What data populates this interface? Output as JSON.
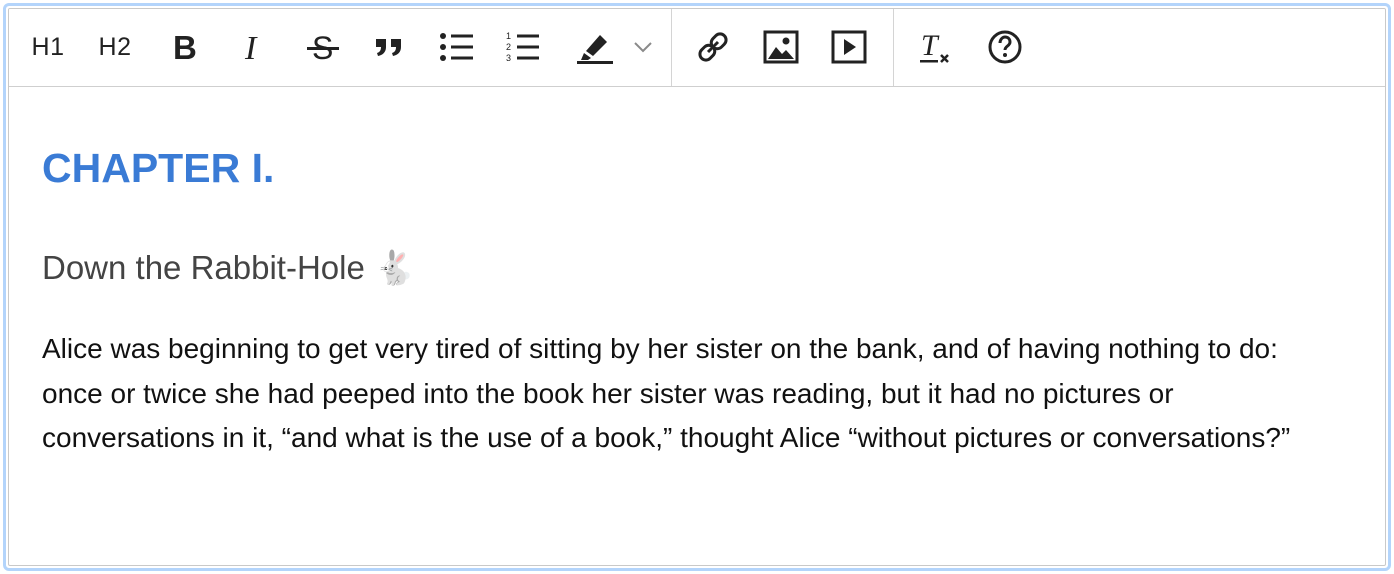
{
  "toolbar": {
    "h1_label": "H1",
    "h2_label": "H2",
    "buttons": [
      {
        "name": "heading-1-button",
        "icon": "H1"
      },
      {
        "name": "heading-2-button",
        "icon": "H2"
      },
      {
        "name": "bold-button",
        "icon": "bold-icon"
      },
      {
        "name": "italic-button",
        "icon": "italic-icon"
      },
      {
        "name": "strikethrough-button",
        "icon": "strikethrough-icon"
      },
      {
        "name": "blockquote-button",
        "icon": "quote-icon"
      },
      {
        "name": "bullet-list-button",
        "icon": "bullet-list-icon"
      },
      {
        "name": "ordered-list-button",
        "icon": "numbered-list-icon"
      },
      {
        "name": "highlight-button",
        "icon": "highlighter-icon"
      },
      {
        "name": "highlight-dropdown-button",
        "icon": "chevron-down-icon"
      },
      {
        "name": "link-button",
        "icon": "link-icon"
      },
      {
        "name": "image-button",
        "icon": "image-icon"
      },
      {
        "name": "video-button",
        "icon": "play-icon"
      },
      {
        "name": "clear-formatting-button",
        "icon": "clear-format-icon"
      },
      {
        "name": "help-button",
        "icon": "help-icon"
      }
    ]
  },
  "document": {
    "heading": "CHAPTER I.",
    "subheading": "Down the Rabbit-Hole 🐇",
    "paragraph": "Alice was beginning to get very tired of sitting by her sister on the bank, and of having nothing to do: once or twice she had peeped into the book her sister was reading, but it had no pictures or conversations in it, “and what is the use of a book,” thought Alice “without pictures or conversations?”"
  },
  "colors": {
    "focus_ring": "#b3d4fb",
    "heading": "#3a7bd5",
    "subheading": "#444444",
    "body_text": "#111111",
    "icon": "#222222"
  }
}
